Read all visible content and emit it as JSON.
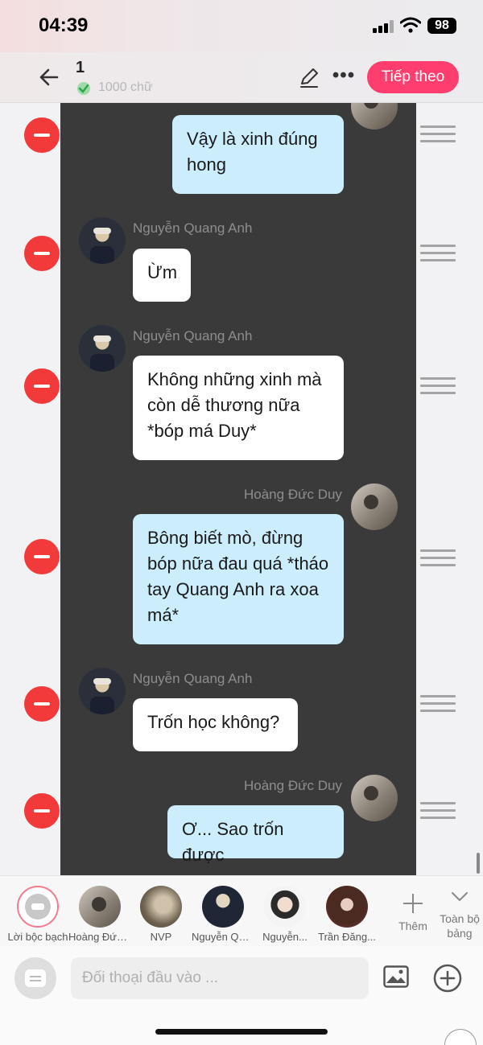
{
  "status_bar": {
    "time": "04:39",
    "battery": "98"
  },
  "header": {
    "chapter_number": "1",
    "word_count": "1000 chữ",
    "next_label": "Tiếp theo"
  },
  "messages": [
    {
      "sender": "",
      "text": "Vậy là xinh đúng hong",
      "side": "right",
      "color": "blue"
    },
    {
      "sender": "Nguyễn Quang Anh",
      "text": "Ừm",
      "side": "left",
      "color": "white"
    },
    {
      "sender": "Nguyễn Quang Anh",
      "text": "Không những xinh mà còn dễ thương nữa *bóp má Duy*",
      "side": "left",
      "color": "white"
    },
    {
      "sender": "Hoàng Đức Duy",
      "text": "Bông biết mò, đừng bóp nữa đau quá *tháo tay Quang Anh ra xoa má*",
      "side": "right",
      "color": "blue"
    },
    {
      "sender": "Nguyễn Quang Anh",
      "text": "Trốn học không?",
      "side": "left",
      "color": "white"
    },
    {
      "sender": "Hoàng Đức Duy",
      "text": "Ơ... Sao trốn được",
      "side": "right",
      "color": "blue"
    }
  ],
  "characters": [
    {
      "label": "Lời bộc bạch",
      "icon": "narration-icon"
    },
    {
      "label": "Hoàng Đức Duy",
      "icon": "avatar"
    },
    {
      "label": "NVP",
      "icon": "avatar"
    },
    {
      "label": "Nguyễn Quang Anh",
      "icon": "avatar"
    },
    {
      "label": "Nguyễn...",
      "icon": "avatar"
    },
    {
      "label": "Trần Đăng...",
      "icon": "avatar"
    }
  ],
  "more_label": "Thêm",
  "expand_label": "Toàn bộ bảng",
  "input": {
    "placeholder": "Đối thoại đầu vào ..."
  },
  "colors": {
    "accent": "#ff3d6f",
    "delete": "#f23a3a",
    "bubble_blue": "#cceefc",
    "panel_dark": "#3a3a3a"
  }
}
